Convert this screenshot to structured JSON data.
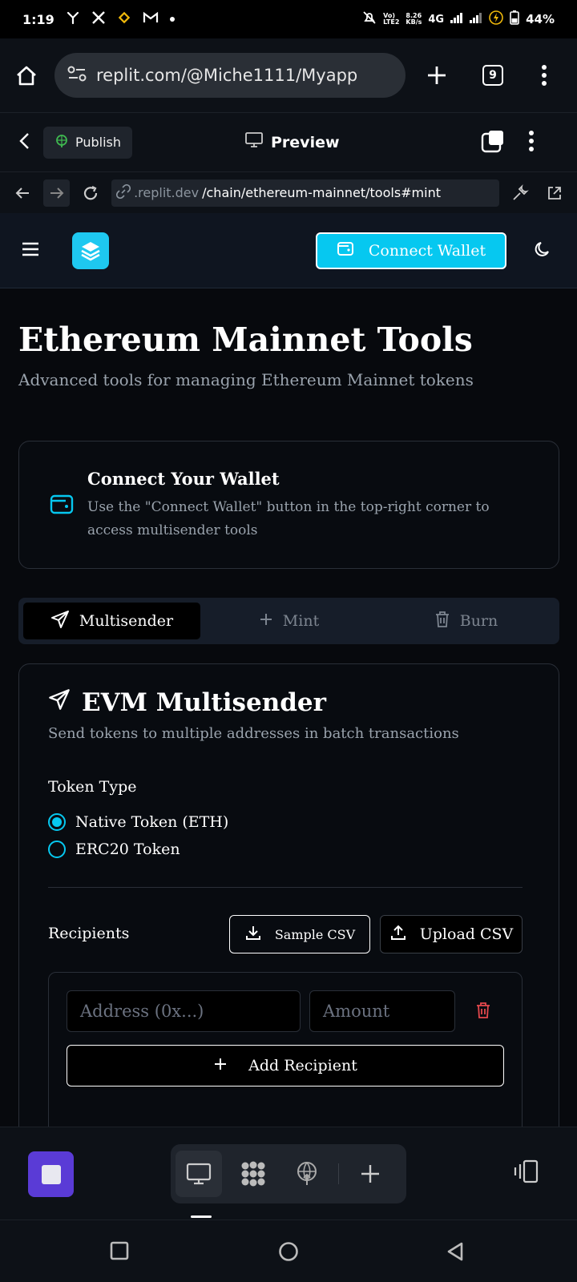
{
  "status_bar": {
    "time": "1:19",
    "net_tech": "4G",
    "net_speed": "8.26",
    "net_speed_unit": "KB/s",
    "volte_top": "Vo)",
    "volte_bottom": "LTE2",
    "battery": "44%"
  },
  "browser": {
    "url": "replit.com/@Miche1111/Myapp",
    "tab_count": "9"
  },
  "replit_bar": {
    "publish_label": "Publish",
    "preview_label": "Preview"
  },
  "preview_url": {
    "prefix": ".replit.dev",
    "path": "/chain/ethereum-mainnet/tools#mint"
  },
  "app": {
    "accent": "#06c8f0",
    "header": {
      "connect_label": "Connect Wallet"
    },
    "title": "Ethereum Mainnet Tools",
    "subtitle": "Advanced tools for managing Ethereum Mainnet tokens",
    "wallet_card": {
      "title": "Connect Your Wallet",
      "desc": "Use the \"Connect Wallet\" button in the top-right corner to access multisender tools"
    },
    "tabs": [
      {
        "label": "Multisender",
        "icon": "send-icon"
      },
      {
        "label": "Mint",
        "icon": "plus-icon"
      },
      {
        "label": "Burn",
        "icon": "trash-icon"
      }
    ],
    "multisender": {
      "title": "EVM Multisender",
      "desc": "Send tokens to multiple addresses in batch transactions",
      "token_type_label": "Token Type",
      "options": [
        "Native Token (ETH)",
        "ERC20 Token"
      ],
      "selected_option": "Native Token (ETH)",
      "recipients_label": "Recipients",
      "sample_csv_label": "Sample CSV",
      "upload_csv_label": "Upload CSV",
      "address_placeholder": "Address (0x...)",
      "amount_placeholder": "Amount",
      "add_recipient_label": "Add Recipient"
    }
  }
}
